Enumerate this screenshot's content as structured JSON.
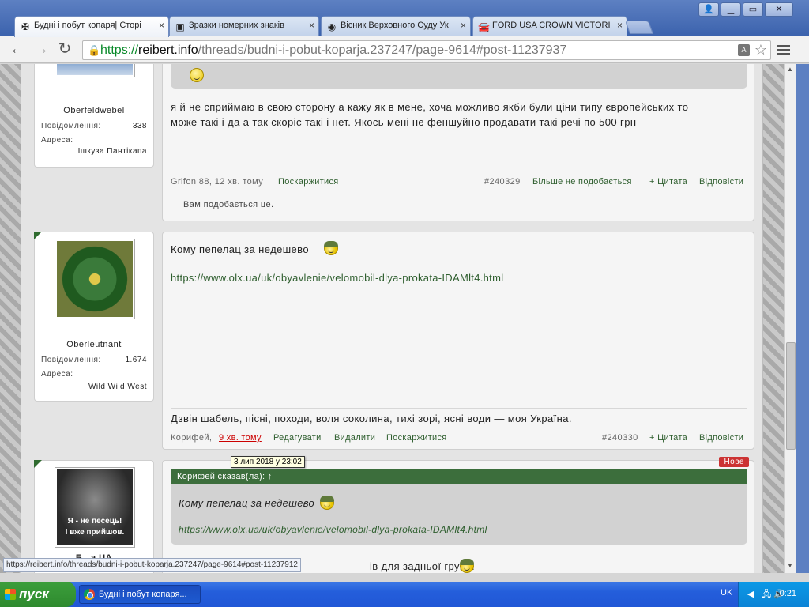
{
  "tabs": [
    {
      "title": "Будні і побут копаря| Сторі",
      "favicon": "iron-cross-icon"
    },
    {
      "title": "Зразки номерних знаків",
      "favicon": "emblem-icon"
    },
    {
      "title": "Вісник Верховного Суду Ук",
      "favicon": "seal-icon"
    },
    {
      "title": "FORD USA CROWN VICTORI",
      "favicon": "car-icon"
    }
  ],
  "address": {
    "scheme": "https://",
    "host": "reibert.info",
    "path": "/threads/budni-i-pobut-koparja.237247/page-9614#post-11237937"
  },
  "posts": [
    {
      "user": {
        "rank": "Oberfeldwebel",
        "messages_label": "Повідомлення:",
        "messages": "338",
        "address_label": "Адреса:",
        "location": "Ішкуза Пантікапа"
      },
      "text": "я й не сприймаю в свою сторону а кажу як в мене, хоча можливо якби були ціни типу європейських то",
      "text2": "може такі і да а так скоріє такі і нет. Якось мені не феншуйно продавати такі речі по 500 грн",
      "author_time": "Grifon 88, 12 хв. тому",
      "report": "Поскаржитися",
      "number": "#240329",
      "unlike": "Більше не подобається",
      "quote": "+ Цитата",
      "reply": "Відповісти",
      "likes": "Вам подобається це."
    },
    {
      "user": {
        "rank": "Oberleutnant",
        "messages_label": "Повідомлення:",
        "messages": "1.674",
        "address_label": "Адреса:",
        "location": "Wild Wild West"
      },
      "text": "Кому пепелац за недешево",
      "link": "https://www.olx.ua/uk/obyavlenie/velomobil-dlya-prokata-IDAMlt4.html",
      "signature": "Дзвін шабель, пісні, походи, воля соколина, тихі зорі, ясні води — моя Україна.",
      "author": "Корифей,",
      "time": "9 хв. тому",
      "edit": "Редагувати",
      "delete": "Видалити",
      "report": "Поскаржитися",
      "number": "#240330",
      "quote": "+ Цитата",
      "reply": "Відповісти"
    },
    {
      "user": {
        "avatar_line1": "Я - не песець!",
        "avatar_line2": "І вже прийшов.",
        "name_partial": "Б...а UA"
      },
      "badge": "Нове",
      "quote_header": "Корифей сказав(ла): ↑",
      "quote_text": "Кому пепелац за недешево",
      "quote_link": "https://www.olx.ua/uk/obyavlenie/velomobil-dlya-prokata-IDAMlt4.html",
      "text_partial": "ів для задньої групи."
    }
  ],
  "tooltip": "3 лип 2018 у 23:02",
  "status_url": "https://reibert.info/threads/budni-i-pobut-koparja.237247/page-9614#post-11237912",
  "taskbar": {
    "start": "пуск",
    "item": "Будні і побут копаря...",
    "lang": "UK",
    "clock": "0:21"
  }
}
